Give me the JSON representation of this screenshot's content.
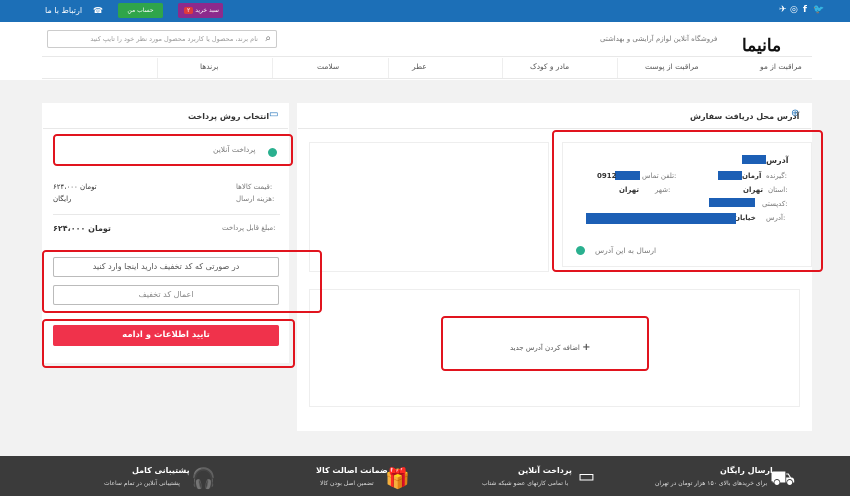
{
  "topbar": {
    "contact": "ارتباط با ما",
    "account": "حساب من",
    "cart": "سبد خرید",
    "cart_count": "۲",
    "social": [
      "twitter-icon",
      "facebook-icon",
      "instagram-icon",
      "telegram-icon"
    ]
  },
  "header": {
    "logo": "مانیما",
    "tagline": "فروشگاه آنلاین لوازم آرایشی و بهداشتی",
    "search_placeholder": "نام برند، محصول یا کاربرد محصول مورد نظر خود را تایپ کنید",
    "nav": [
      "مراقبت از مو",
      "مراقبت از پوست",
      "مادر و کودک",
      "عطر",
      "سلامت",
      "برندها"
    ]
  },
  "address": {
    "title": "آدرس محل دریافت سفارش",
    "heading": "آدرس",
    "receiver_label": "گیرنده:",
    "receiver_value": "آرمان",
    "phone_label": "تلفن تماس:",
    "phone_value": "0912",
    "province_label": "استان:",
    "province_value": "تهران",
    "city_label": "شهر:",
    "city_value": "تهران",
    "postal_label": "کدپستی:",
    "addr_label": "آدرس:",
    "addr_value": "خیابان",
    "send_here": "ارسال به این آدرس",
    "add_new": "اضافه کردن آدرس جدید"
  },
  "payment": {
    "title": "انتخاب روش پرداخت",
    "online": "پرداخت آنلاین",
    "items_price_label": "قیمت کالاها:",
    "items_price_value": "۶۲۴،۰۰۰ تومان",
    "shipping_label": "هزینه ارسال:",
    "shipping_value": "رایگان",
    "payable_label": "مبلغ قابل پرداخت:",
    "payable_value": "۶۲۴،۰۰۰ تومان",
    "discount_placeholder": "در صورتی که کد تخفیف دارید اینجا وارد کنید",
    "apply_discount": "اعمال کد تخفیف",
    "confirm": "تایید اطلاعات و ادامه"
  },
  "footer": [
    {
      "title": "ارسال رایگان",
      "sub": "برای خریدهای بالای ۱۵۰ هزار تومان در تهران",
      "icon": "truck-icon"
    },
    {
      "title": "پرداخت آنلاین",
      "sub": "با تمامی کارتهای عضو شبکه شتاب",
      "icon": "credit-card-icon"
    },
    {
      "title": "ضمانت اصالت کالا",
      "sub": "تضمین اصل بودن کالا",
      "icon": "gift-icon"
    },
    {
      "title": "پشتیبانی کامل",
      "sub": "پشتیبانی آنلاین در تمام ساعات",
      "icon": "headset-icon"
    }
  ]
}
